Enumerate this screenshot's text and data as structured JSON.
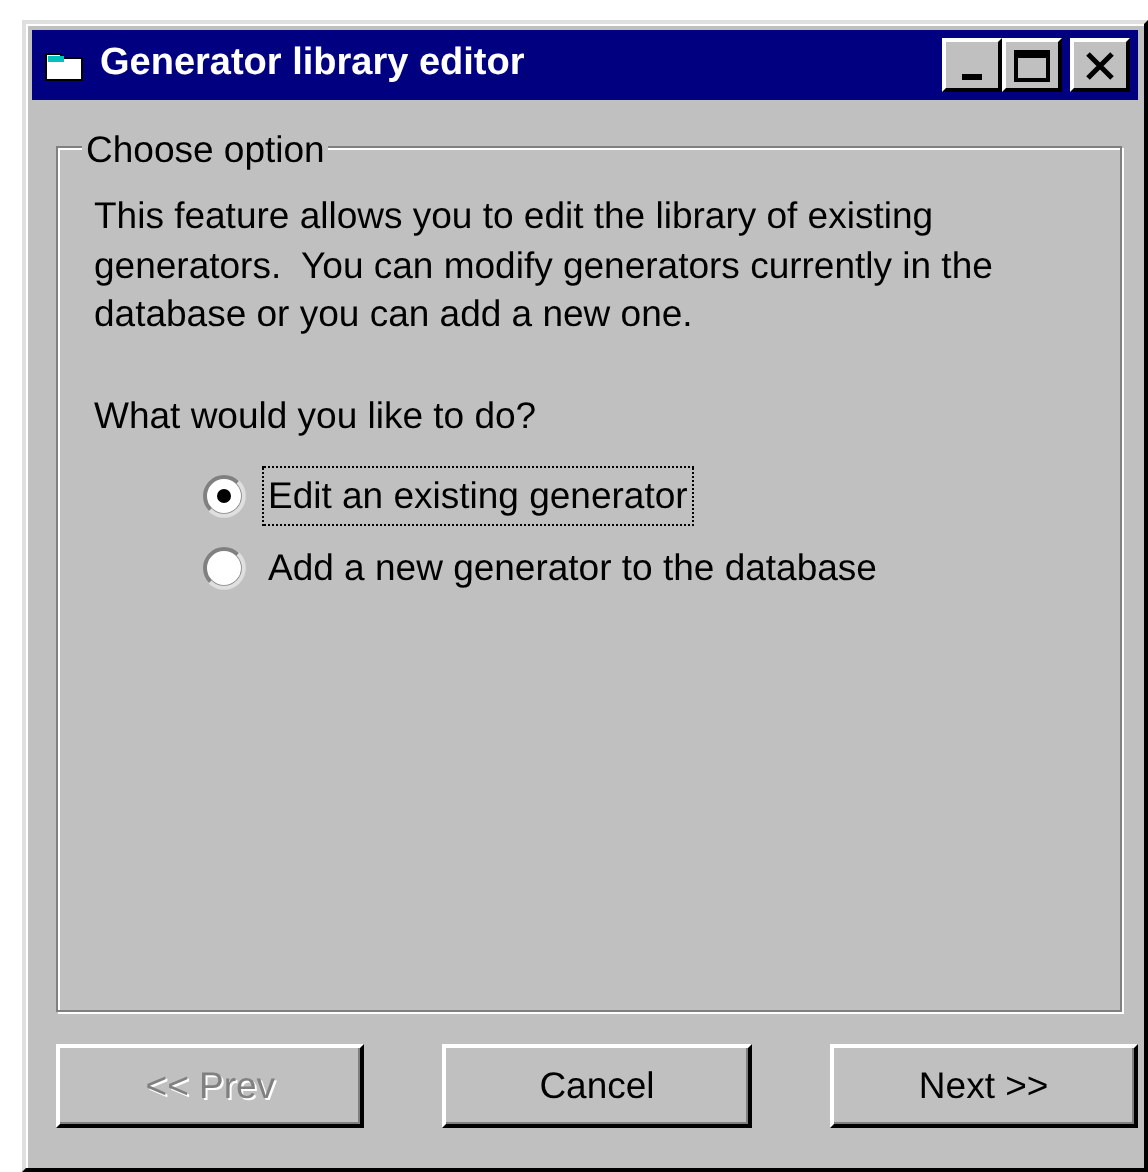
{
  "window": {
    "title": "Generator library editor"
  },
  "group": {
    "title": "Choose option",
    "description": "This feature allows you to edit the library of existing generators.  You can modify generators currently in the database or you can add a new one.",
    "question": "What would you like to do?",
    "options": [
      {
        "label": "Edit an existing generator",
        "selected": true,
        "focused": true
      },
      {
        "label": "Add a new generator to the database",
        "selected": false,
        "focused": false
      }
    ]
  },
  "buttons": [
    {
      "label": "<< Prev",
      "disabled": true
    },
    {
      "label": "Cancel",
      "disabled": false
    },
    {
      "label": "Next >>",
      "disabled": false
    }
  ]
}
